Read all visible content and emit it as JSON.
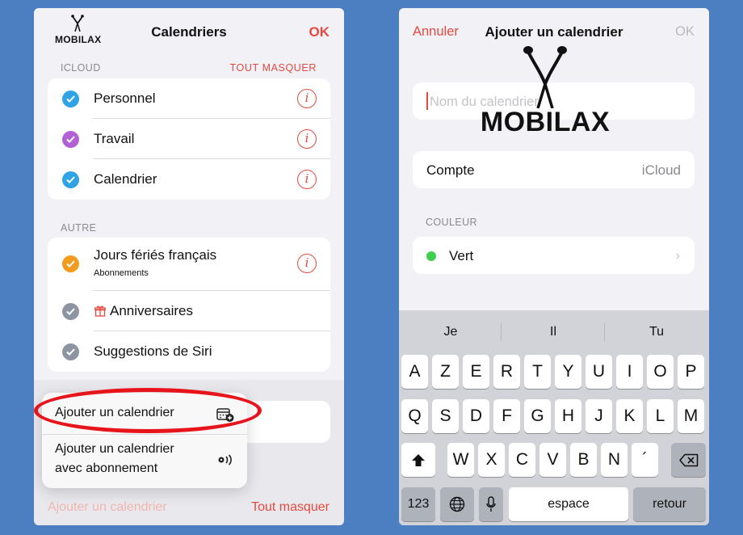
{
  "left": {
    "logo_text": "MOBILAX",
    "title": "Calendriers",
    "ok": "OK",
    "section_icloud": "ICLOUD",
    "hide_all_top": "TOUT MASQUER",
    "icloud_items": [
      {
        "label": "Personnel",
        "color": "#2ea3e6"
      },
      {
        "label": "Travail",
        "color": "#b35fd6"
      },
      {
        "label": "Calendrier",
        "color": "#2ea3e6"
      }
    ],
    "section_other": "AUTRE",
    "other_items": [
      {
        "label": "Jours fériés français",
        "sublabel": "Abonnements",
        "color": "#f39b1e"
      },
      {
        "label": "Anniversaires",
        "color": "#8d95a3",
        "icon": "gift-icon"
      },
      {
        "label": "Suggestions de Siri",
        "color": "#8d95a3"
      }
    ],
    "menu": {
      "add_calendar": "Ajouter un calendrier",
      "add_subscription_line1": "Ajouter un calendrier",
      "add_subscription_line2": "avec abonnement"
    },
    "footer_left": "Ajouter un calendrier",
    "footer_right": "Tout masquer"
  },
  "right": {
    "cancel": "Annuler",
    "title": "Ajouter un calendrier",
    "ok": "OK",
    "name_placeholder": "Nom du calendrier",
    "account_label": "Compte",
    "account_value": "iCloud",
    "section_color": "COULEUR",
    "color_name": "Vert",
    "logo_text": "MOBILAX",
    "keyboard": {
      "suggestions": [
        "Je",
        "Il",
        "Tu"
      ],
      "row1": [
        "A",
        "Z",
        "E",
        "R",
        "T",
        "Y",
        "U",
        "I",
        "O",
        "P"
      ],
      "row2": [
        "Q",
        "S",
        "D",
        "F",
        "G",
        "H",
        "J",
        "K",
        "L",
        "M"
      ],
      "row3": [
        "W",
        "X",
        "C",
        "V",
        "B",
        "N",
        "´"
      ],
      "numbers_key": "123",
      "space_key": "espace",
      "return_key": "retour"
    }
  }
}
